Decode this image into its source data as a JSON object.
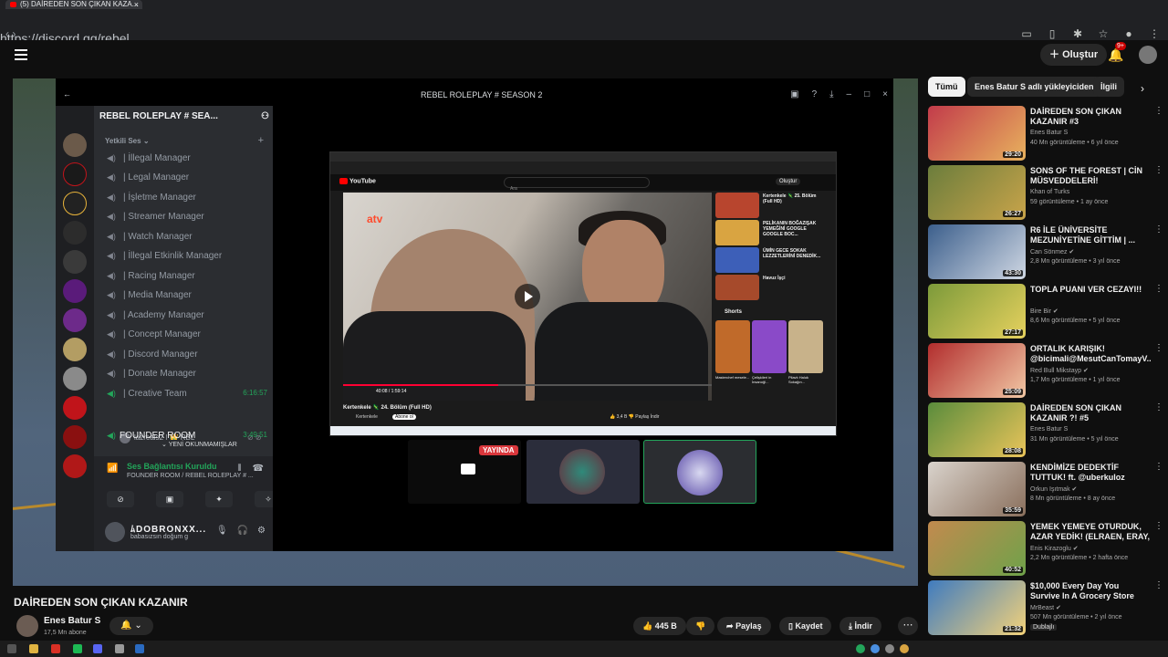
{
  "browser": {
    "tab_title": "(5) DAİREDEN SON ÇIKAN KAZA...",
    "address_fragment": "https://discord.gg/rebel"
  },
  "youtube": {
    "create_label": "Oluştur",
    "notification_count": "9+"
  },
  "discord": {
    "window_title": "REBEL ROLEPLAY # SEASON 2",
    "server_name": "REBEL ROLEPLAY # SEA...",
    "category": "Yetkili Ses",
    "channels": [
      {
        "label": "| İllegal Manager"
      },
      {
        "label": "| Legal Manager"
      },
      {
        "label": "| İşletme Manager"
      },
      {
        "label": "| Streamer Manager"
      },
      {
        "label": "| Watch Manager"
      },
      {
        "label": "| İllegal Etkinlik Manager"
      },
      {
        "label": "| Racing Manager"
      },
      {
        "label": "| Media Manager"
      },
      {
        "label": "| Academy Manager"
      },
      {
        "label": "| Concept Manager"
      },
      {
        "label": "| Discord Manager"
      },
      {
        "label": "| Donate Manager"
      },
      {
        "label": "| Creative Team",
        "time": "6:16:57"
      },
      {
        "label": "FOUNDER ROOM",
        "time": "3:49:51"
      }
    ],
    "member_name": "lazreals2 | 👑 RBL",
    "new_messages": "YENİ OKUNMAMIŞLAR",
    "voice_status": "Ses Bağlantısı Kuruldu",
    "voice_channel": "FOUNDER ROOM / REBEL ROLEPLAY # ...",
    "user_name": "ﾑDOBRONXX...",
    "user_status": "babasızsın doğum g",
    "live_badge": "YAYINDA"
  },
  "shared_screen": {
    "video_title": "Kertenkele 🦎 24. Bölüm (Full HD)",
    "channel": "Kertenkele",
    "subscribe": "Abone ol",
    "time": "40:08 / 1:59:14",
    "search_placeholder": "Ara",
    "create": "Oluştur",
    "actions": "👍 3,4 B   👎   Paylaş   İndir",
    "shorts_label": "Shorts",
    "side_items": [
      "Kertenkele 🦎 25. Bölüm (Full HD)",
      "PELİKANIN BOĞAZIŞAK YEMEĞİNİ GOOGLE GOOGLE BOC...",
      "ÜMİN GECE SOKAK LEZZETLERİNİ DENEDİK...",
      "Havuz İşçi"
    ],
    "shorts_captions": [
      "Masterchef mesele...",
      "Çelişkileri in İnsanoğl...",
      "Pilavlı Haluk Sokağın..."
    ]
  },
  "video": {
    "title": "DAİREDEN SON ÇIKAN KAZANIR",
    "channel_name": "Enes Batur S",
    "subscribers": "17,5 Mn abone",
    "likes": "445 B",
    "share": "Paylaş",
    "save": "Kaydet",
    "download": "İndir"
  },
  "sidebar": {
    "chips": [
      "Tümü",
      "Enes Batur S adlı yükleyiciden",
      "İlgili"
    ],
    "recommendations": [
      {
        "title": "DAİREDEN SON ÇIKAN KAZANIR #3",
        "channel": "Enes Batur S",
        "meta": "40 Mn görüntüleme • 6 yıl önce",
        "duration": "29:20",
        "colors": [
          "#c23b4a",
          "#e8b25e"
        ]
      },
      {
        "title": "SONS OF THE FOREST | CİN MÜSVEDDELERİ!",
        "channel": "Khan of Turks",
        "meta": "59 görüntüleme • 1 ay önce",
        "duration": "26:27",
        "colors": [
          "#6b7d3c",
          "#c9a44a"
        ]
      },
      {
        "title": "R6 İLE ÜNİVERSİTE MEZUNİYETİNE GİTTİM | ...",
        "channel": "Can Sönmez ✔",
        "meta": "2,8 Mn görüntüleme • 3 yıl önce",
        "duration": "43:30",
        "colors": [
          "#3c5f8c",
          "#cfd7e3"
        ]
      },
      {
        "title": "TOPLA PUANI VER CEZAYI!!",
        "channel": "Bire Bir ✔",
        "meta": "8,6 Mn görüntüleme • 5 yıl önce",
        "duration": "27:17",
        "colors": [
          "#7c9a3a",
          "#e6d15e"
        ]
      },
      {
        "title": "ORTALIK KARIŞIK! @bicimali@MesutCanTomayV...",
        "channel": "Red Bull Mikstayp ✔",
        "meta": "1,7 Mn görüntüleme • 1 yıl önce",
        "duration": "25:09",
        "colors": [
          "#b22d2d",
          "#f1c7a4"
        ]
      },
      {
        "title": "DAİREDEN SON ÇIKAN KAZANIR ?! #5",
        "channel": "Enes Batur S",
        "meta": "31 Mn görüntüleme • 5 yıl önce",
        "duration": "28:08",
        "colors": [
          "#5a8c3c",
          "#e9c45a"
        ]
      },
      {
        "title": "KENDİMİZE DEDEKTİF TUTTUK! ft. @uberkuloz",
        "channel": "Orkun Işıtmak ✔",
        "meta": "8 Mn görüntüleme • 8 ay önce",
        "duration": "35:59",
        "colors": [
          "#d9d3cc",
          "#8a6f5c"
        ]
      },
      {
        "title": "YEMEK YEMEYE OTURDUK, AZAR YEDİK! (ELRAEN, ERAY, ...",
        "channel": "Enis Kirazoglu ✔",
        "meta": "2,2 Mn görüntüleme • 2 hafta önce",
        "duration": "40:52",
        "colors": [
          "#c28a4e",
          "#6fa24a"
        ]
      },
      {
        "title": "$10,000 Every Day You Survive In A Grocery Store",
        "channel": "MrBeast ✔",
        "meta": "507 Mn görüntüleme • 2 yıl önce",
        "duration": "21:32",
        "badge": "Dublajlı",
        "colors": [
          "#3f7bbf",
          "#f3d27a"
        ]
      }
    ]
  }
}
